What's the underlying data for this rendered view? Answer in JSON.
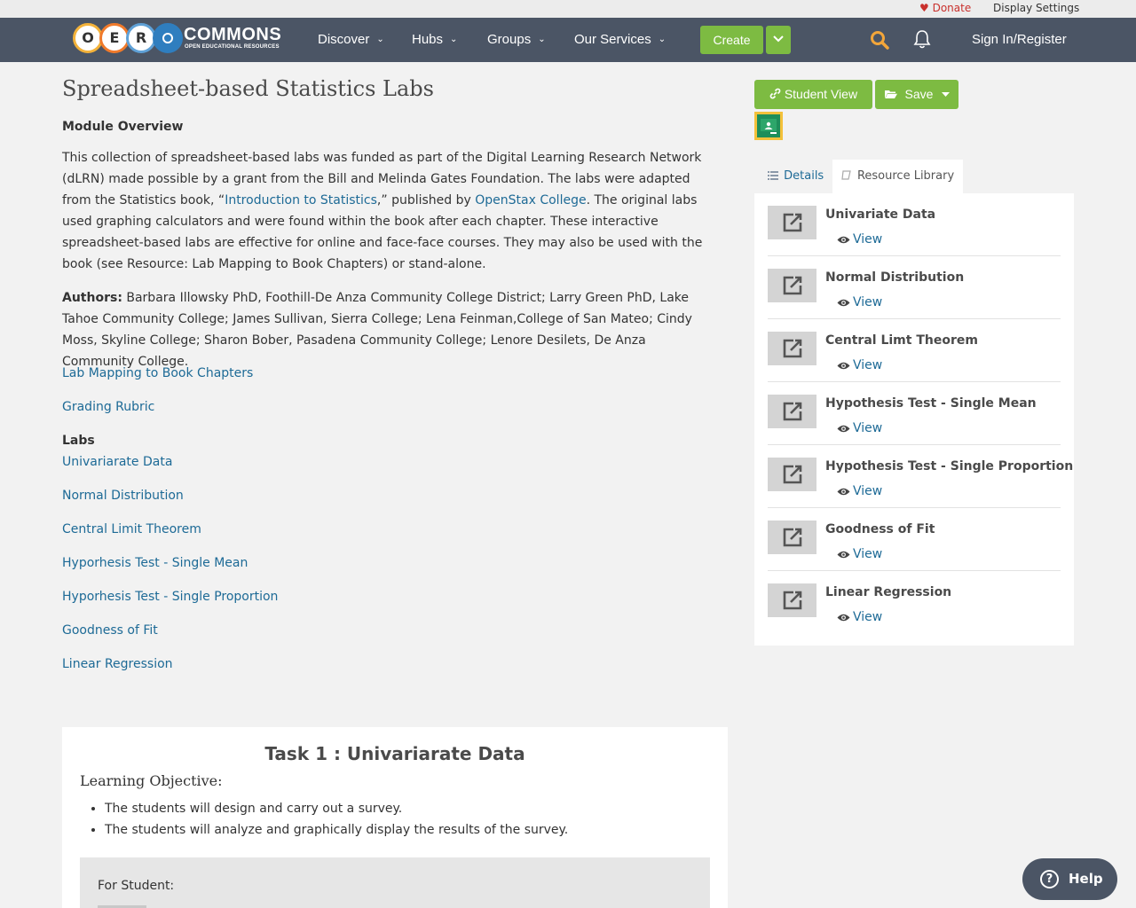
{
  "utility": {
    "donate": "Donate",
    "display_settings": "Display Settings"
  },
  "nav": {
    "logo_wordmark": "COMMONS",
    "logo_tagline": "OPEN EDUCATIONAL RESOURCES",
    "logo_letters": [
      "O",
      "E",
      "R"
    ],
    "items": [
      "Discover",
      "Hubs",
      "Groups",
      "Our Services"
    ],
    "create": "Create",
    "signin": "Sign In/Register"
  },
  "main": {
    "title": "Spreadsheet-based Statistics Labs",
    "module_overview": "Module Overview",
    "overview_part1": "This collection of spreadsheet-based labs was funded as part of the Digital Learning Research Network (dLRN) made possible by a grant from the Bill and Melinda Gates Foundation. The labs were adapted from the Statistics book, “",
    "overview_link1": "Introduction to Statistics",
    "overview_part2": ",” published by ",
    "overview_link2": "OpenStax College",
    "overview_part3": ". The original labs used graphing calculators and were found within the book after each chapter. These interactive spreadsheet-based labs are effective for online and face-face courses. They may also be used with the book (see Resource: Lab Mapping to Book Chapters) or stand-alone.",
    "authors_label": "Authors:",
    "authors_text": " Barbara Illowsky PhD, Foothill-De Anza Community College District; Larry Green PhD, Lake Tahoe Community College; James Sullivan, Sierra College; Lena Feinman,College of San Mateo; Cindy Moss, Skyline College; Sharon Bober, Pasadena Community College; Lenore Desilets, De Anza Community College.",
    "link_mapping": "Lab Mapping to Book Chapters",
    "link_rubric": "Grading Rubric",
    "labs_heading": "Labs",
    "labs": [
      "Univariarate Data",
      "Normal Distribution",
      "Central Limit Theorem",
      "Hyporhesis Test - Single Mean",
      "Hyporhesis Test - Single Proportion",
      "Goodness of Fit",
      "Linear Regression"
    ]
  },
  "task": {
    "title": "Task 1 : Univariarate Data",
    "learning_objective": "Learning Objective:",
    "objectives": [
      "The students will design and carry out a survey.",
      "The students will analyze and graphically display the results of the survey."
    ],
    "for_student": "For Student:"
  },
  "sidebar": {
    "student_view": "Student View",
    "save": "Save",
    "tab_details": "Details",
    "tab_library": "Resource Library",
    "resources": [
      {
        "title": "Univariate Data",
        "view": "View"
      },
      {
        "title": "Normal Distribution",
        "view": "View"
      },
      {
        "title": "Central Limt Theorem",
        "view": "View"
      },
      {
        "title": "Hypothesis Test - Single Mean",
        "view": "View"
      },
      {
        "title": "Hypothesis Test - Single Proportion",
        "view": "View"
      },
      {
        "title": "Goodness of Fit",
        "view": "View"
      },
      {
        "title": "Linear Regression",
        "view": "View"
      }
    ]
  },
  "help": {
    "label": "Help",
    "icon_glyph": "?"
  },
  "colors": {
    "nav_bg": "#4b5565",
    "accent_green": "#7dbb42",
    "link_blue": "#1d6a96",
    "search_orange": "#f3a63a",
    "donate_red": "#c9302c"
  }
}
